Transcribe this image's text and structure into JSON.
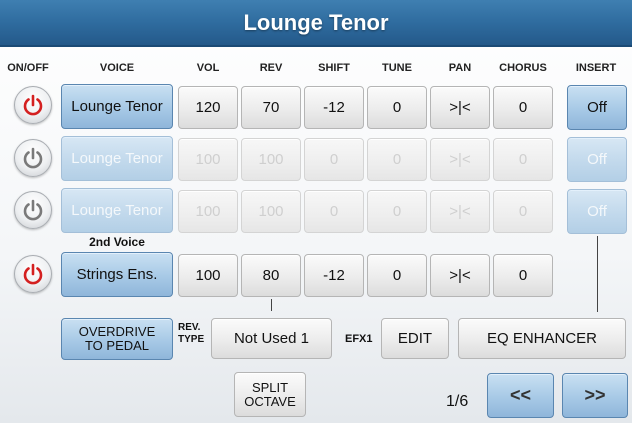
{
  "title": "Lounge Tenor",
  "headers": {
    "onoff": "ON/OFF",
    "voice": "VOICE",
    "vol": "VOL",
    "rev": "REV",
    "shift": "SHIFT",
    "tune": "TUNE",
    "pan": "PAN",
    "chorus": "CHORUS",
    "insert": "INSERT"
  },
  "rows": [
    {
      "power": "on",
      "voice": "Lounge Tenor",
      "vol": "120",
      "rev": "70",
      "shift": "-12",
      "tune": "0",
      "pan": ">|<",
      "chorus": "0",
      "insert": "Off",
      "enabled": true
    },
    {
      "power": "off",
      "voice": "Lounge Tenor",
      "vol": "100",
      "rev": "100",
      "shift": "0",
      "tune": "0",
      "pan": ">|<",
      "chorus": "0",
      "insert": "Off",
      "enabled": false
    },
    {
      "power": "off",
      "voice": "Lounge Tenor",
      "vol": "100",
      "rev": "100",
      "shift": "0",
      "tune": "0",
      "pan": ">|<",
      "chorus": "0",
      "insert": "Off",
      "enabled": false
    },
    {
      "power": "on",
      "voice": "Strings Ens.",
      "vol": "100",
      "rev": "80",
      "shift": "-12",
      "tune": "0",
      "pan": ">|<",
      "chorus": "0",
      "insert": "",
      "enabled": true
    }
  ],
  "second_voice_label": "2nd Voice",
  "overdrive": {
    "line1": "OVERDRIVE",
    "line2": "TO PEDAL"
  },
  "rev_type": {
    "line1": "REV.",
    "line2": "TYPE",
    "value": "Not Used 1"
  },
  "efx": {
    "label": "EFX1",
    "edit": "EDIT",
    "value": "EQ ENHANCER"
  },
  "split_octave": {
    "line1": "SPLIT",
    "line2": "OCTAVE"
  },
  "page": "1/6",
  "nav": {
    "prev": "<<",
    "next": ">>"
  },
  "colors": {
    "title_bar": "#2f6c9f",
    "power_on": "#d42020",
    "power_off": "#7a7a7a",
    "button_blue": "#a7c9e6"
  },
  "icons": {
    "power": "power-icon"
  }
}
